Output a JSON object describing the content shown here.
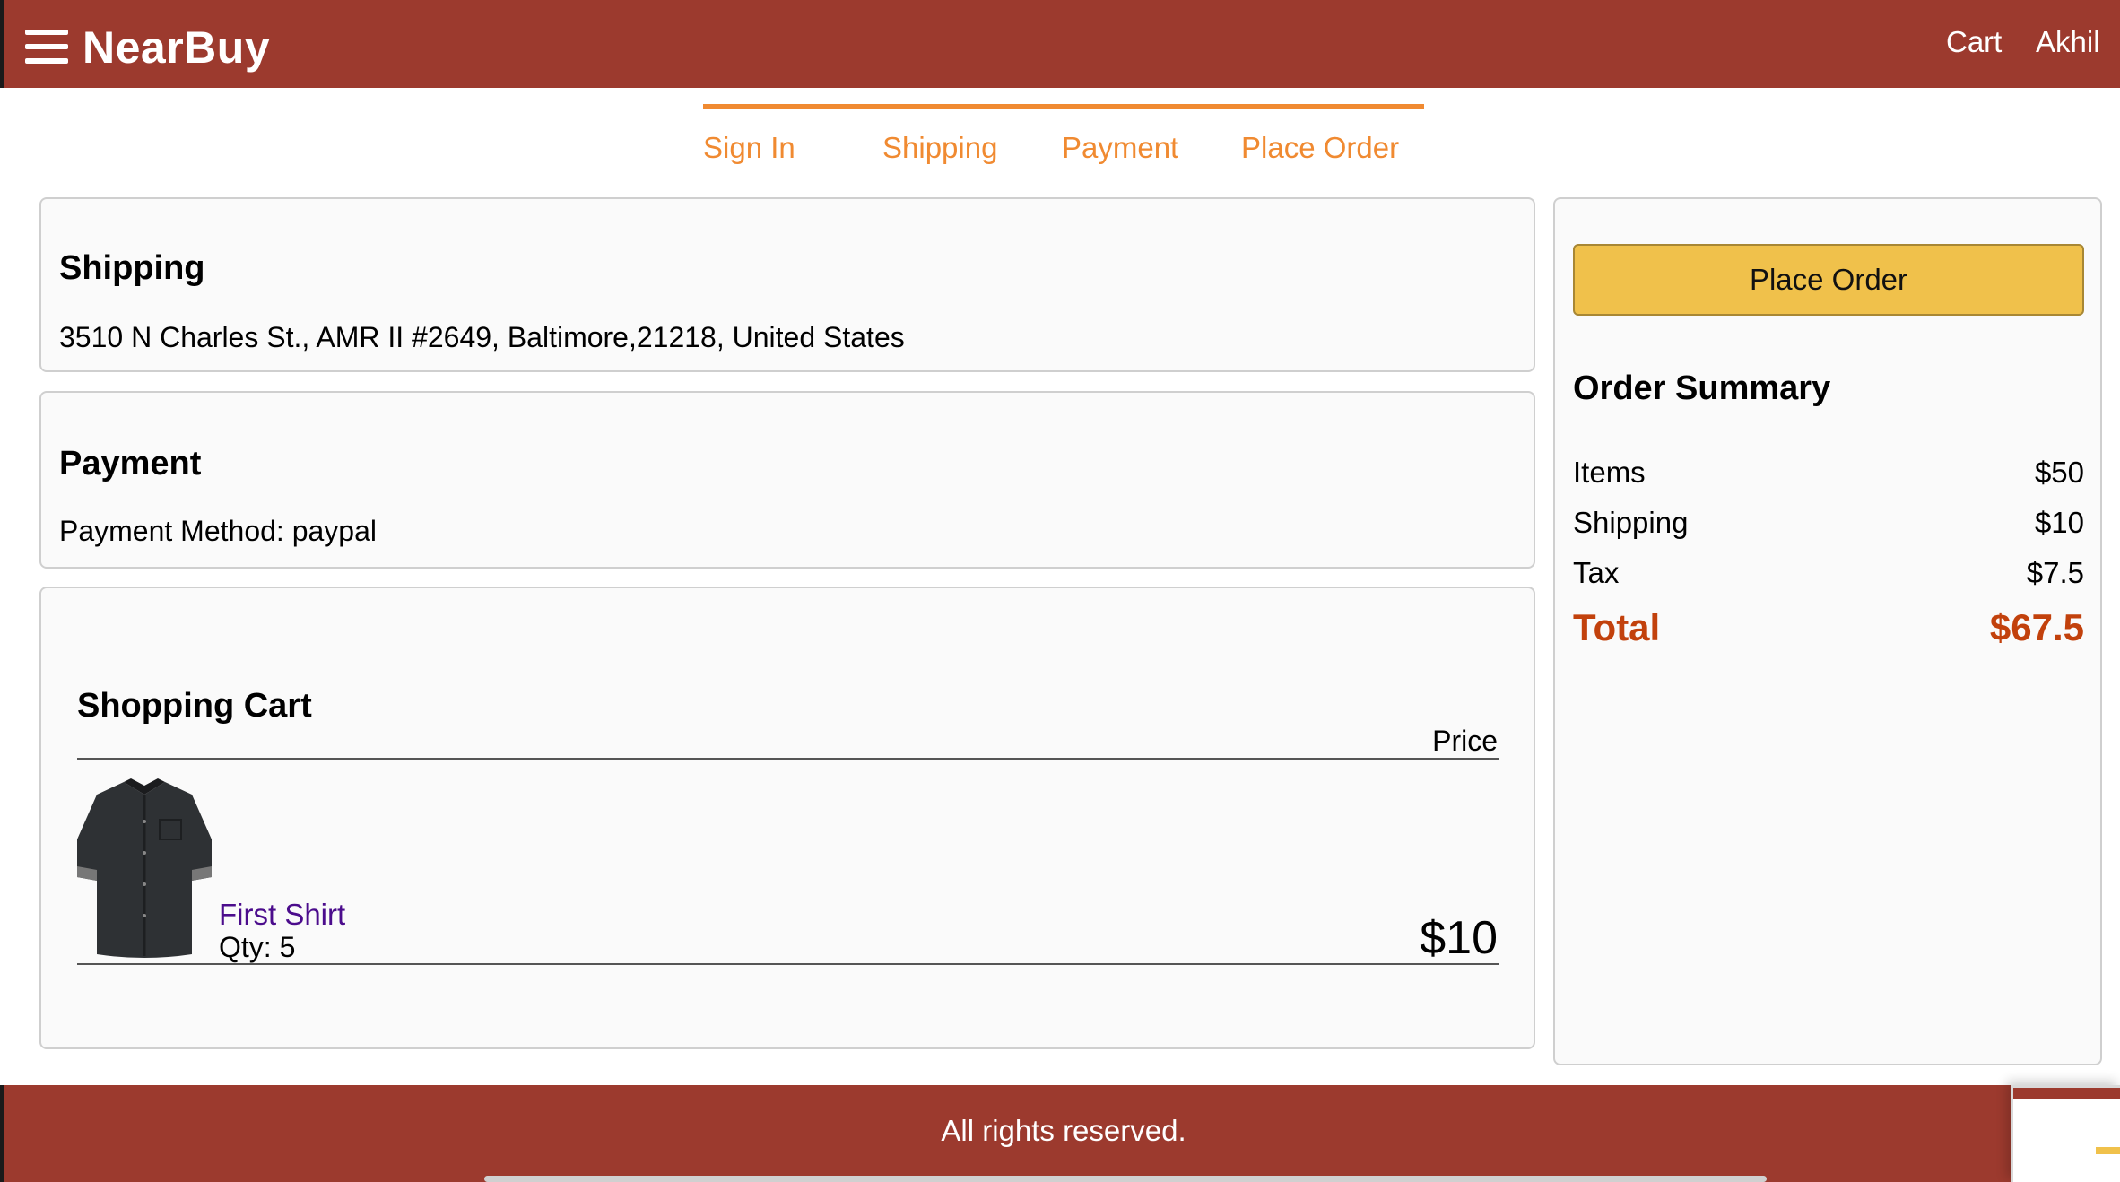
{
  "header": {
    "brand": "NearBuy",
    "menu_icon": "hamburger-icon",
    "links": [
      "Cart",
      "Akhil"
    ]
  },
  "steps": [
    "Sign In",
    "Shipping",
    "Payment",
    "Place Order"
  ],
  "shipping": {
    "title": "Shipping",
    "address": "3510 N Charles St., AMR II #2649, Baltimore,21218, United States"
  },
  "payment": {
    "title": "Payment",
    "method": "Payment Method: paypal"
  },
  "cart": {
    "title": "Shopping Cart",
    "price_header": "Price",
    "items": [
      {
        "name": "First Shirt",
        "qty": "Qty: 5",
        "price": "$10",
        "image": "shirt-image"
      }
    ]
  },
  "summary": {
    "button": "Place Order",
    "title": "Order Summary",
    "rows": [
      {
        "label": "Items",
        "value": "$50"
      },
      {
        "label": "Shipping",
        "value": "$10"
      },
      {
        "label": "Tax",
        "value": "$7.5"
      }
    ],
    "total_label": "Total",
    "total_value": "$67.5"
  },
  "footer": {
    "text": "All rights reserved."
  },
  "colors": {
    "header_bg": "#9c3a2e",
    "step_accent": "#f08a31",
    "button_bg": "#f0c14b",
    "total_color": "#c2410c",
    "product_link": "#4b0c8c"
  }
}
